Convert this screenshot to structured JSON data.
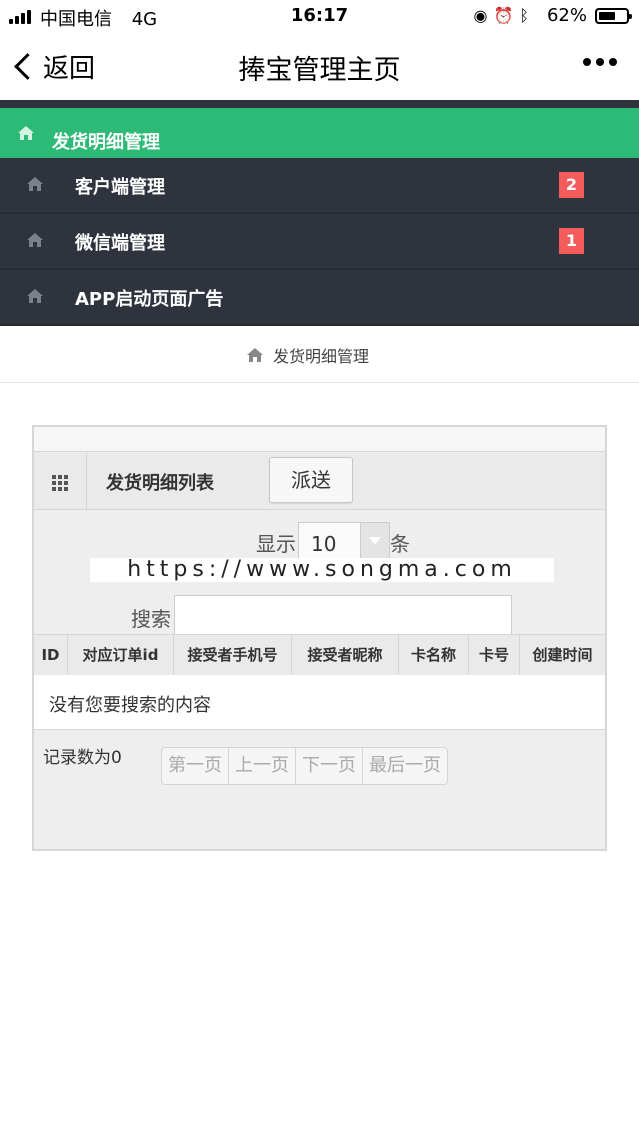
{
  "status_bar": {
    "carrier": "中国电信",
    "network": "4G",
    "time": "16:17",
    "battery": "62%",
    "battery_level": 0.62,
    "icons": [
      "orientation-lock-icon",
      "alarm-icon",
      "bluetooth-icon"
    ]
  },
  "nav": {
    "back_label": "返回",
    "title": "捧宝管理主页",
    "more_icon": "more-dots-icon"
  },
  "menu": {
    "active": {
      "label": "发货明细管理",
      "icon": "home-icon"
    },
    "items": [
      {
        "label": "客户端管理",
        "badge": "2",
        "icon": "home-icon"
      },
      {
        "label": "微信端管理",
        "badge": "1",
        "icon": "home-icon"
      },
      {
        "label": "APP启动页面广告",
        "badge": "",
        "icon": "home-icon"
      }
    ]
  },
  "breadcrumb": {
    "label": "发货明细管理",
    "icon": "home-icon"
  },
  "panel": {
    "title": "发货明细列表",
    "dispatch_button": "派送",
    "show_prefix": "显示",
    "page_size": "10",
    "show_suffix": "条",
    "watermark": "https://www.songma.com",
    "search_label": "搜索",
    "search_value": "",
    "columns": [
      "ID",
      "对应订单id",
      "接受者手机号",
      "接受者昵称",
      "卡名称",
      "卡号",
      "创建时间"
    ],
    "empty_message": "没有您要搜索的内容",
    "record_count": "记录数为0",
    "pager": [
      "第一页",
      "上一页",
      "下一页",
      "最后一页"
    ]
  },
  "colors": {
    "menu_active": "#2cba76",
    "menu_bg": "#2e333d",
    "badge": "#f45c5c"
  }
}
